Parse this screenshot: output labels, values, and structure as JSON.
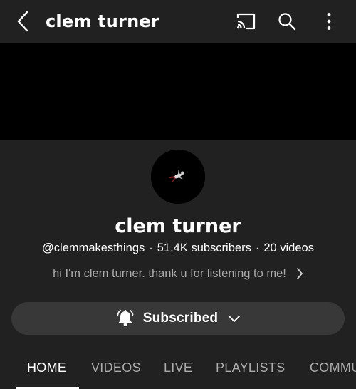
{
  "topbar": {
    "title": "clem turner",
    "back_icon": "back-chevron-icon",
    "cast_icon": "cast-icon",
    "search_icon": "search-icon",
    "more_icon": "more-vertical-icon"
  },
  "channel": {
    "name": "clem turner",
    "handle": "@clemmakesthings",
    "subscribers": "51.4K subscribers",
    "videos": "20 videos",
    "separator": "·",
    "about": "hi I'm clem turner. thank u for listening to me!"
  },
  "subscribe": {
    "label": "Subscribed",
    "bell_icon": "bell-icon",
    "chevron_icon": "chevron-down-icon"
  },
  "tabs": [
    {
      "label": "HOME",
      "active": true
    },
    {
      "label": "VIDEOS",
      "active": false
    },
    {
      "label": "LIVE",
      "active": false
    },
    {
      "label": "PLAYLISTS",
      "active": false
    },
    {
      "label": "COMMUNITY",
      "active": false
    }
  ],
  "colors": {
    "background": "#212121",
    "banner": "#000000",
    "pill": "#383838",
    "muted_text": "#aaaaaa",
    "text": "#ffffff"
  }
}
